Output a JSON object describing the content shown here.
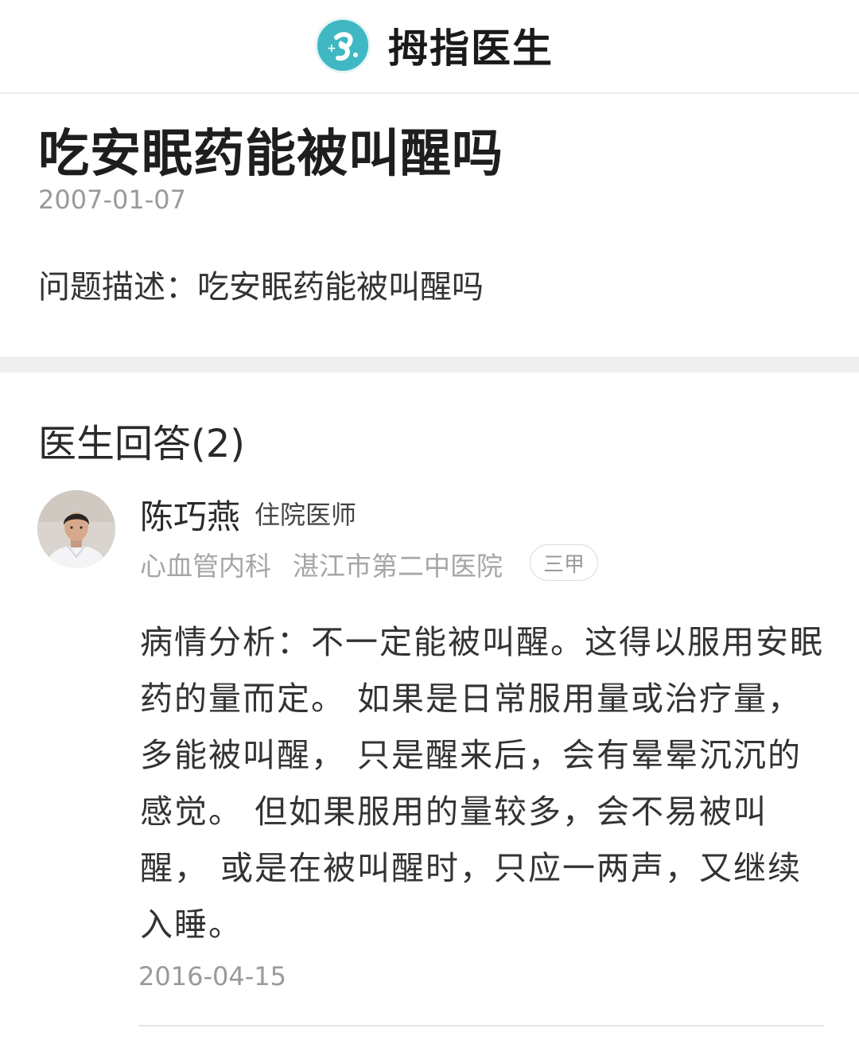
{
  "header": {
    "brand_name": "拇指医生",
    "logo_icon": "thumb-doctor-logo-icon",
    "brand_color": "#3fb8c3"
  },
  "question": {
    "title": "吃安眠药能被叫醒吗",
    "date": "2007-01-07",
    "description": "问题描述：吃安眠药能被叫醒吗"
  },
  "answers": {
    "section_title": "医生回答(2)",
    "items": [
      {
        "doctor_name": "陈巧燕",
        "doctor_title": "住院医师",
        "department": "心血管内科",
        "hospital": "湛江市第二中医院",
        "hospital_level": "三甲",
        "content": "病情分析：不一定能被叫醒。这得以服用安眠药的量而定。 如果是日常服用量或治疗量，多能被叫醒， 只是醒来后，会有晕晕沉沉的感觉。 但如果服用的量较多，会不易被叫醒， 或是在被叫醒时，只应一两声，又继续入睡。",
        "date": "2016-04-15"
      }
    ]
  }
}
